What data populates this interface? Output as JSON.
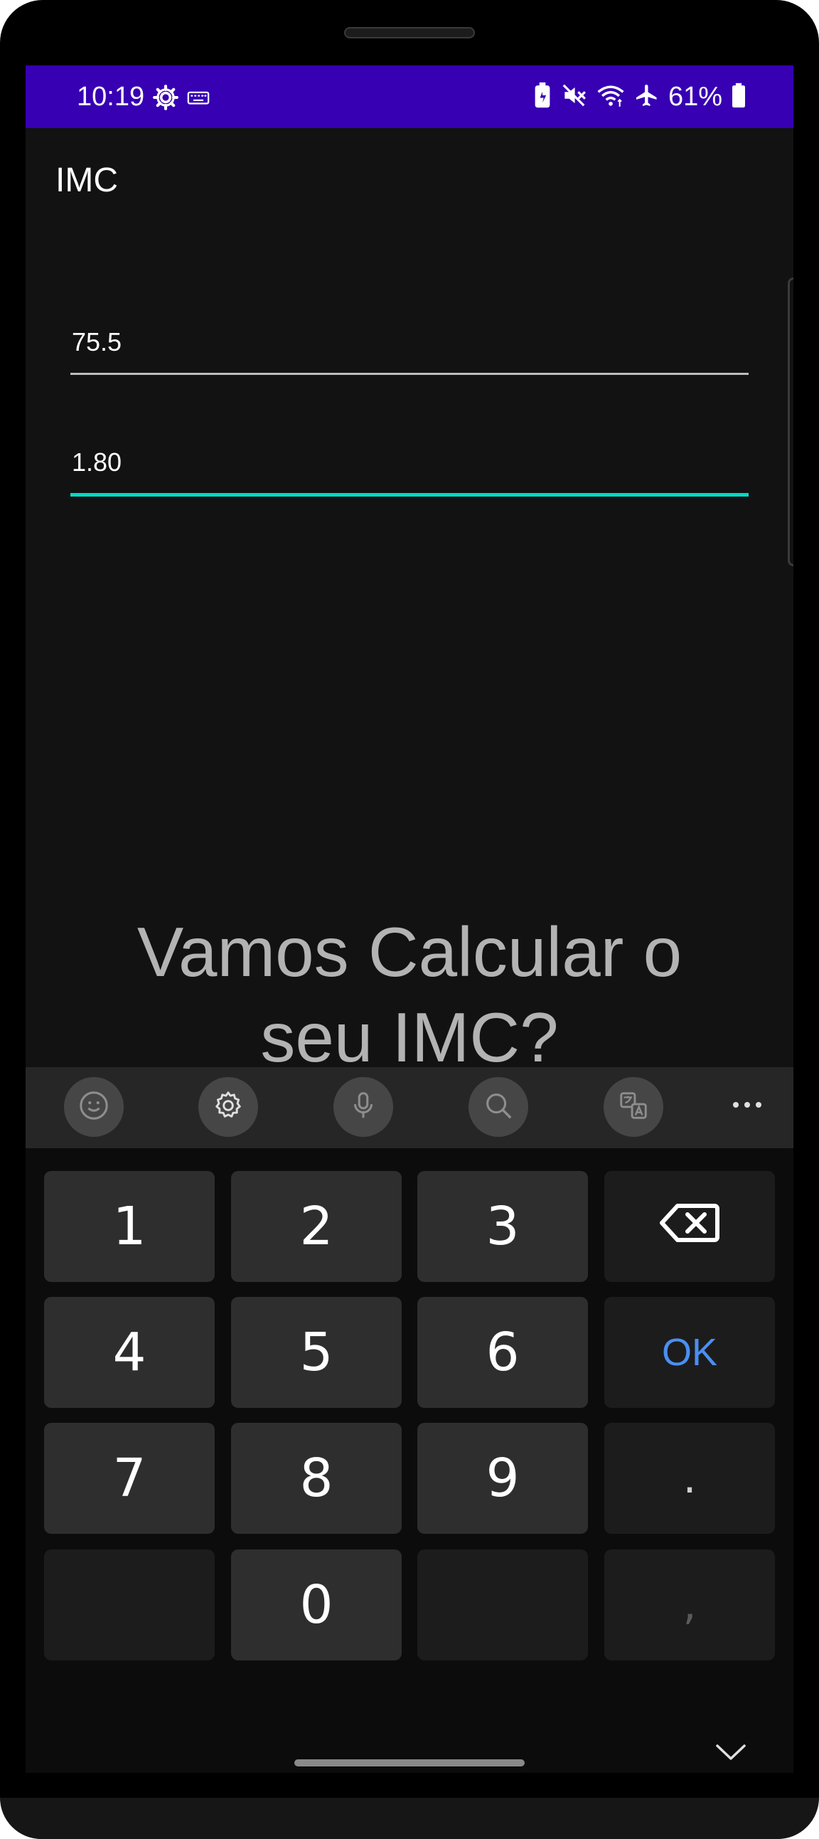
{
  "status_bar": {
    "time": "10:19",
    "battery_percent": "61%",
    "left_icons": [
      "settings-gear-icon",
      "keyboard-icon"
    ],
    "right_icons": [
      "battery-saver-icon",
      "mute-icon",
      "wifi-icon",
      "airplane-mode-icon",
      "battery-icon"
    ],
    "background_color": "#3700b3"
  },
  "app_bar": {
    "title": "IMC"
  },
  "form": {
    "weight_value": "75.5",
    "height_value": "1.80",
    "focused_field": "height",
    "accent_color": "#03dac5"
  },
  "headline": {
    "line1": "Vamos Calcular o",
    "line2": "seu IMC?"
  },
  "keyboard": {
    "toolbar": [
      "emoji-icon",
      "settings-icon",
      "microphone-icon",
      "search-icon",
      "translate-icon",
      "more-icon"
    ],
    "keys": {
      "k1": "1",
      "k2": "2",
      "k3": "3",
      "k4": "4",
      "k5": "5",
      "k6": "6",
      "k7": "7",
      "k8": "8",
      "k9": "9",
      "k0": "0",
      "ok": "OK",
      "dot": ".",
      "comma": ","
    },
    "ok_color": "#4a8ff2"
  }
}
